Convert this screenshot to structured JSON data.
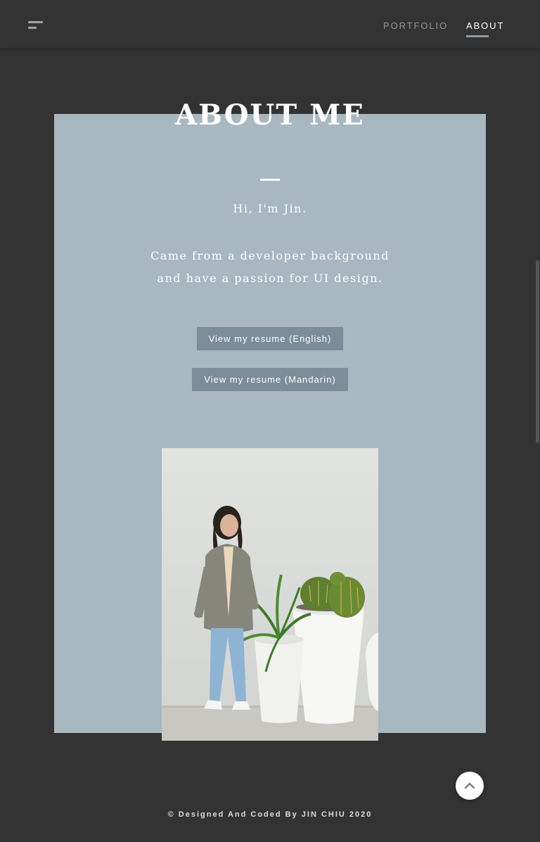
{
  "nav": {
    "links": [
      {
        "label": "PORTFOLIO"
      },
      {
        "label": "ABOUT",
        "active": true
      }
    ]
  },
  "about": {
    "title": "ABOUT ME",
    "greeting": "Hi, I'm Jin.",
    "bio_line1": "Came from a developer background",
    "bio_line2": "and have a passion for UI design.",
    "resume_english": "View my resume (English)",
    "resume_mandarin": "View my resume (Mandarin)"
  },
  "footer": {
    "text": "© Designed And Coded By JIN CHIU 2020"
  },
  "colors": {
    "page_background": "#333333",
    "card_background": "#a9b7c0",
    "button_background": "#7b8d99",
    "nav_active_underline": "#8a9dab"
  },
  "icons": {
    "menu": "hamburger-menu-icon",
    "back_to_top": "chevron-up-icon"
  }
}
